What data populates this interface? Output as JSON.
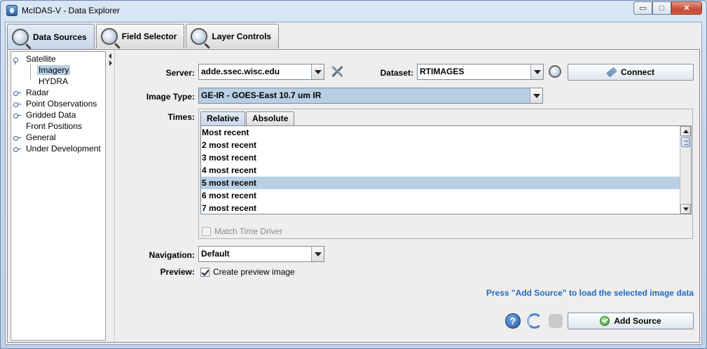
{
  "window": {
    "title": "McIDAS-V - Data Explorer",
    "icon": "mcidas-app-icon",
    "controls": {
      "minimize": "▭",
      "maximize": "□",
      "close": "✕"
    }
  },
  "tabs": [
    {
      "label": "Data Sources",
      "icon": "data-sources-icon",
      "active": true
    },
    {
      "label": "Field Selector",
      "icon": "field-selector-icon",
      "active": false
    },
    {
      "label": "Layer Controls",
      "icon": "layer-controls-icon",
      "active": false
    }
  ],
  "tree": {
    "items": [
      {
        "label": "Satellite",
        "level": 0,
        "expanded": true
      },
      {
        "label": "Imagery",
        "level": 1,
        "selected": true
      },
      {
        "label": "HYDRA",
        "level": 1
      },
      {
        "label": "Radar",
        "level": 0
      },
      {
        "label": "Point Observations",
        "level": 0
      },
      {
        "label": "Gridded Data",
        "level": 0
      },
      {
        "label": "Front Positions",
        "level": 0
      },
      {
        "label": "General",
        "level": 0
      },
      {
        "label": "Under Development",
        "level": 0
      }
    ]
  },
  "form": {
    "server_label": "Server:",
    "server_value": "adde.ssec.wisc.edu",
    "dataset_label": "Dataset:",
    "dataset_value": "RTIMAGES",
    "connect_label": "Connect",
    "image_type_label": "Image Type:",
    "image_type_value": "GE-IR - GOES-East 10.7 um IR",
    "times_label": "Times:",
    "times_tabs": [
      "Relative",
      "Absolute"
    ],
    "times_items": [
      "Most recent",
      "2 most recent",
      "3 most recent",
      "4 most recent",
      "5 most recent",
      "6 most recent",
      "7 most recent"
    ],
    "times_selected_index": 4,
    "match_time_driver_label": "Match Time Driver",
    "match_time_driver_checked": false,
    "navigation_label": "Navigation:",
    "navigation_value": "Default",
    "preview_label": "Preview:",
    "preview_checkbox_label": "Create preview image",
    "preview_checked": true,
    "hint_text": "Press \"Add Source\" to load the selected image data",
    "add_source_label": "Add Source",
    "help_glyph": "?"
  },
  "colors": {
    "selection": "#b8cfe5",
    "hint_text": "#1f6bc4",
    "panel_bg": "#eeeeee",
    "frame_bg": "#bcd0e6"
  }
}
